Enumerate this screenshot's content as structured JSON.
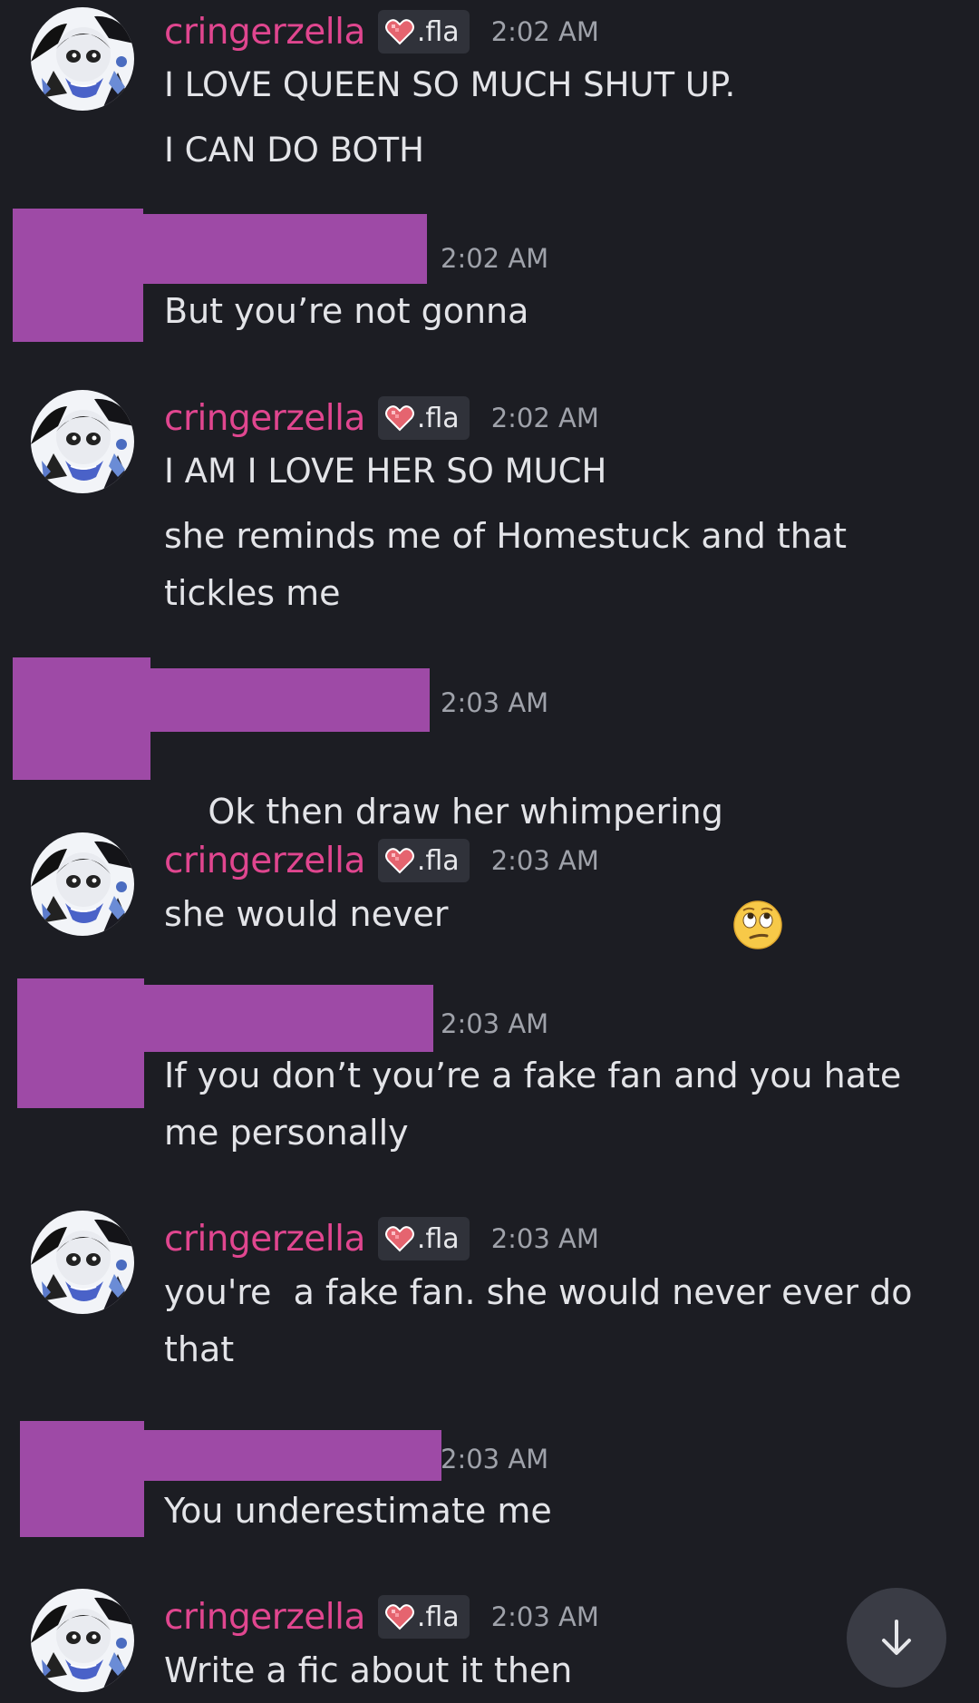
{
  "messages": [
    {
      "author": "cringerzella",
      "tag": ".fla",
      "time": "2:02 AM",
      "lines": [
        "I LOVE QUEEN SO MUCH SHUT UP.",
        "I CAN DO BOTH"
      ]
    },
    {
      "author": "",
      "time": "2:02 AM",
      "lines": [
        "But you’re not gonna"
      ]
    },
    {
      "author": "cringerzella",
      "tag": ".fla",
      "time": "2:02 AM",
      "lines": [
        "I AM I LOVE HER SO MUCH",
        "she reminds me of Homestuck and that tickles me"
      ]
    },
    {
      "author": "",
      "time": "2:03 AM",
      "lines": [
        "Ok then draw her whimpering"
      ],
      "emoji": "face-with-rolling-eyes"
    },
    {
      "author": "cringerzella",
      "tag": ".fla",
      "time": "2:03 AM",
      "lines": [
        "she would never"
      ]
    },
    {
      "author": "",
      "time": "2:03 AM",
      "lines": [
        "If you don’t you’re a fake fan and you hate me personally"
      ]
    },
    {
      "author": "cringerzella",
      "tag": ".fla",
      "time": "2:03 AM",
      "lines": [
        "you're  a fake fan. she would never ever do that"
      ]
    },
    {
      "author": "",
      "time": "2:03 AM",
      "lines": [
        "You underestimate me"
      ]
    },
    {
      "author": "cringerzella",
      "tag": ".fla",
      "time": "2:03 AM",
      "lines": [
        "Write a fic about it then"
      ]
    }
  ],
  "icons": {
    "tag_icon": "pixel-heart-icon",
    "scroll_button": "arrow-down-icon"
  },
  "colors": {
    "background": "#1c1d23",
    "username": "#e0468f",
    "redaction": "#9e4aa6",
    "timestamp": "#9fa2aa",
    "text": "#e3e4e8"
  }
}
